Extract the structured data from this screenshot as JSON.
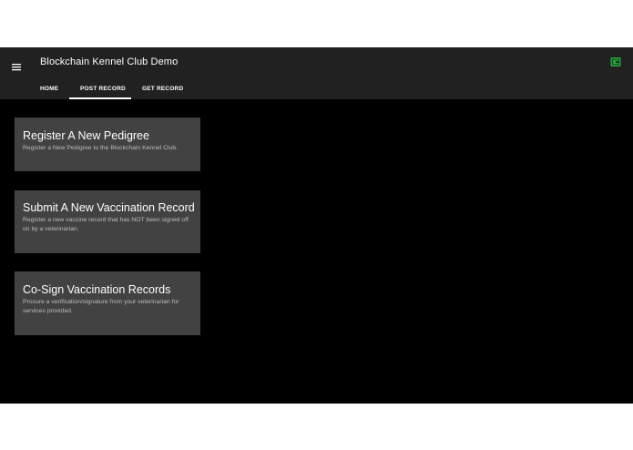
{
  "app": {
    "title": "Blockchain Kennel Club Demo",
    "accent": "#2ea043"
  },
  "icons": {
    "menu": "hamburger-menu-icon",
    "wallet": "wallet-icon"
  },
  "tabs": [
    {
      "label": "HOME",
      "active": false
    },
    {
      "label": "POST RECORD",
      "active": true
    },
    {
      "label": "GET RECORD",
      "active": false
    }
  ],
  "cards": [
    {
      "title": "Register A New Pedigree",
      "description": "Register a New Pedigree to the Blockchain Kennel Club."
    },
    {
      "title": "Submit A New Vaccination Record",
      "description": "Register a new vaccine record that has NOT been signed off on by a veterinarian."
    },
    {
      "title": "Co-Sign Vaccination Records",
      "description": "Procure a verification/signature from your veterinarian for services provided."
    }
  ]
}
